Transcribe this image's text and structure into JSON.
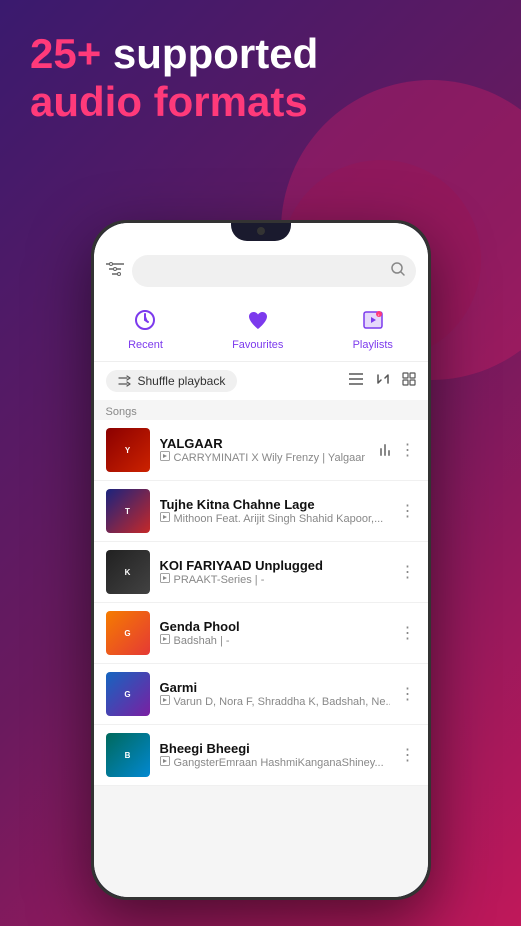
{
  "background": {
    "gradient_start": "#3a1a6e",
    "gradient_end": "#c0185a"
  },
  "header": {
    "line1_highlight": "25+",
    "line1_rest": " supported",
    "line2": "audio formats"
  },
  "search": {
    "placeholder": ""
  },
  "nav_tabs": [
    {
      "id": "recent",
      "label": "Recent",
      "icon": "🕐",
      "active": false
    },
    {
      "id": "favourites",
      "label": "Favourites",
      "icon": "♥",
      "active": false
    },
    {
      "id": "playlists",
      "label": "Playlists",
      "icon": "🎵",
      "active": false
    }
  ],
  "shuffle": {
    "label": "Shuffle playback"
  },
  "sections": [
    {
      "label": "Songs",
      "songs": [
        {
          "title": "YALGAAR",
          "artist": "CARRYMINATI X Wily Frenzy | Yalgaar",
          "art_class": "art-yalgaar",
          "art_text": "Y"
        },
        {
          "title": "Tujhe Kitna Chahne Lage",
          "artist": "Mithoon Feat. Arijit Singh Shahid Kapoor,...",
          "art_class": "art-tujhe",
          "art_text": "T"
        },
        {
          "title": "KOI FARIYAAD Unplugged",
          "artist": "PRAAKT-Series | -",
          "art_class": "art-koi",
          "art_text": "K"
        },
        {
          "title": "Genda Phool",
          "artist": "Badshah | -",
          "art_class": "art-genda",
          "art_text": "G"
        },
        {
          "title": "Garmi",
          "artist": "Varun D, Nora F, Shraddha K, Badshah, Ne...",
          "art_class": "art-garmi",
          "art_text": "G"
        },
        {
          "title": "Bheegi Bheegi",
          "artist": "GangsterEmraan HashmiKanganaShiney...",
          "art_class": "art-bheegi",
          "art_text": "B"
        }
      ]
    }
  ]
}
